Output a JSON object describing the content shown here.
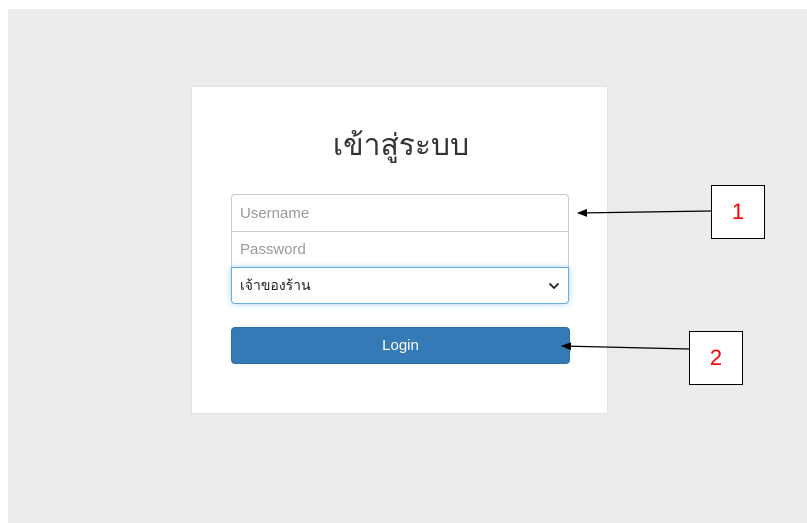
{
  "login": {
    "title": "เข้าสู่ระบบ",
    "username_placeholder": "Username",
    "password_placeholder": "Password",
    "role_selected": "เจ้าของร้าน",
    "login_label": "Login"
  },
  "annotations": {
    "callout_1": "1",
    "callout_2": "2"
  },
  "colors": {
    "background": "#ececec",
    "card": "#ffffff",
    "login_button": "#337ab7",
    "callout_text": "#ff0000"
  },
  "icons": {
    "select_chevron": "chevron-down-icon",
    "annotation_arrow": "arrow-left-icon"
  }
}
